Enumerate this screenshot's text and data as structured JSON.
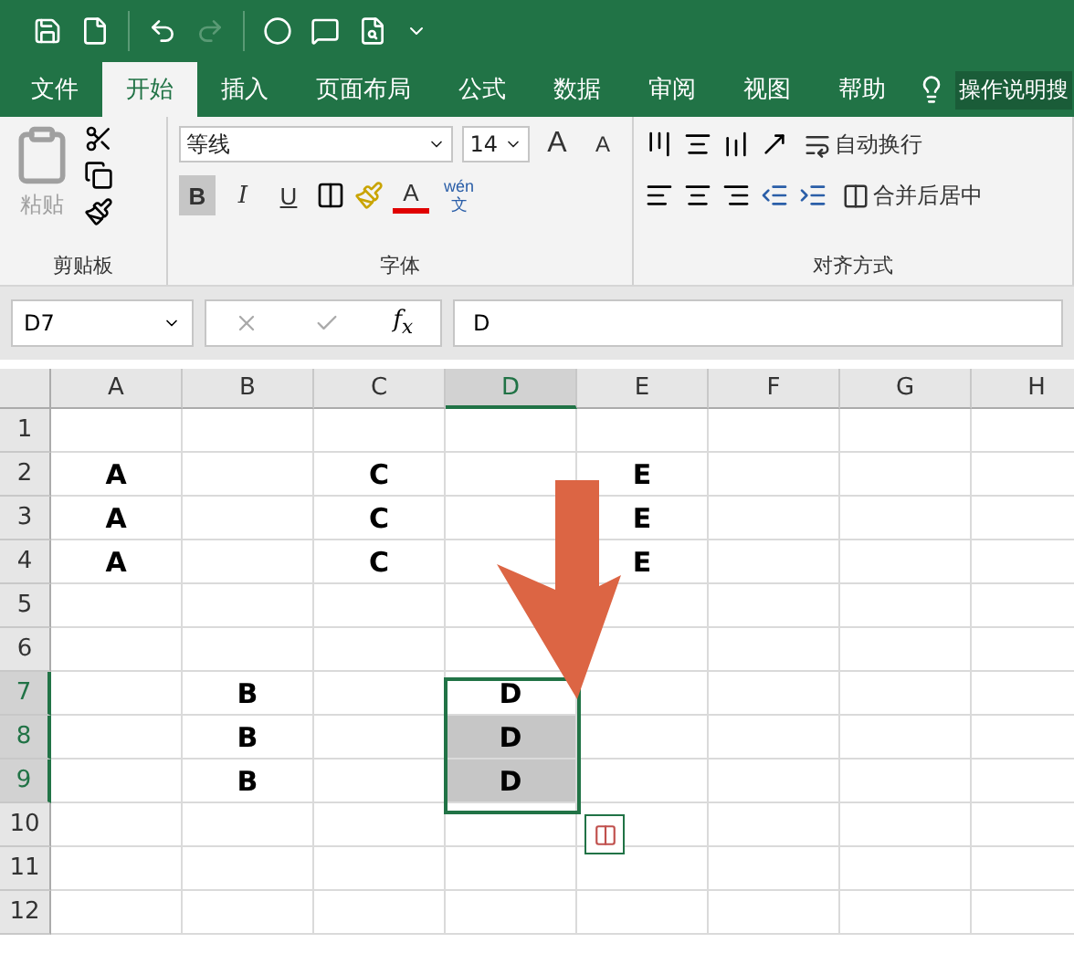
{
  "tabs": [
    {
      "label": "文件",
      "selected": false
    },
    {
      "label": "开始",
      "selected": true
    },
    {
      "label": "插入",
      "selected": false
    },
    {
      "label": "页面布局",
      "selected": false
    },
    {
      "label": "公式",
      "selected": false
    },
    {
      "label": "数据",
      "selected": false
    },
    {
      "label": "审阅",
      "selected": false
    },
    {
      "label": "视图",
      "selected": false
    },
    {
      "label": "帮助",
      "selected": false
    }
  ],
  "tell_me": "操作说明搜",
  "ribbon": {
    "clipboard": {
      "paste": "粘贴",
      "paste_disabled": true,
      "label": "剪贴板"
    },
    "font": {
      "name": "等线",
      "size": "14",
      "grow": "A",
      "shrink": "A",
      "bold": "B",
      "bold_on": true,
      "italic": "I",
      "underline": "U",
      "font_color": "A",
      "phonetic_top": "wén",
      "phonetic_bottom": "文",
      "label": "字体"
    },
    "alignment": {
      "wrap": "自动换行",
      "merge": "合并后居中",
      "label": "对齐方式"
    }
  },
  "name_box": "D7",
  "fx": "f$_{x}$",
  "formula": "D",
  "columns": [
    {
      "label": "A",
      "selected": false
    },
    {
      "label": "B",
      "selected": false
    },
    {
      "label": "C",
      "selected": false
    },
    {
      "label": "D",
      "selected": true
    },
    {
      "label": "E",
      "selected": false
    },
    {
      "label": "F",
      "selected": false
    },
    {
      "label": "G",
      "selected": false
    },
    {
      "label": "H",
      "selected": false
    }
  ],
  "rows": [
    {
      "label": "1",
      "selected": false,
      "cells": {}
    },
    {
      "label": "2",
      "selected": false,
      "cells": {
        "A": "A",
        "C": "C",
        "E": "E"
      }
    },
    {
      "label": "3",
      "selected": false,
      "cells": {
        "A": "A",
        "C": "C",
        "E": "E"
      }
    },
    {
      "label": "4",
      "selected": false,
      "cells": {
        "A": "A",
        "C": "C",
        "E": "E"
      }
    },
    {
      "label": "5",
      "selected": false,
      "cells": {}
    },
    {
      "label": "6",
      "selected": false,
      "cells": {}
    },
    {
      "label": "7",
      "selected": true,
      "active": true,
      "cells": {
        "B": "B",
        "D": "D"
      }
    },
    {
      "label": "8",
      "selected": true,
      "cells": {
        "B": "B",
        "D": "D"
      }
    },
    {
      "label": "9",
      "selected": true,
      "cells": {
        "B": "B",
        "D": "D"
      }
    },
    {
      "label": "10",
      "selected": false,
      "cells": {}
    },
    {
      "label": "11",
      "selected": false,
      "cells": {}
    },
    {
      "label": "12",
      "selected": false,
      "cells": {}
    }
  ]
}
